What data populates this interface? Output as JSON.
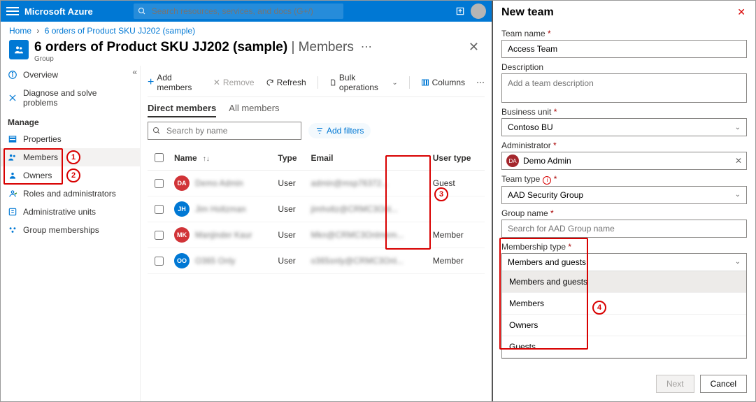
{
  "brand": "Microsoft Azure",
  "search_placeholder": "Search resources, services, and docs (G+/)",
  "breadcrumb": {
    "home": "Home",
    "current": "6 orders of Product SKU JJ202 (sample)"
  },
  "page": {
    "title_main": "6 orders of Product SKU JJ202 (sample)",
    "title_sep": " | ",
    "title_sub": "Members",
    "type": "Group"
  },
  "nav": {
    "overview": "Overview",
    "diagnose": "Diagnose and solve problems",
    "manage_header": "Manage",
    "properties": "Properties",
    "members": "Members",
    "owners": "Owners",
    "roles": "Roles and administrators",
    "admin_units": "Administrative units",
    "group_memberships": "Group memberships"
  },
  "toolbar": {
    "add": "Add members",
    "remove": "Remove",
    "refresh": "Refresh",
    "bulk": "Bulk operations",
    "columns": "Columns"
  },
  "tabs": {
    "direct": "Direct members",
    "all": "All members"
  },
  "search_name_placeholder": "Search by name",
  "add_filters": "Add filters",
  "columns": {
    "name": "Name",
    "type": "Type",
    "email": "Email",
    "user_type": "User type"
  },
  "rows": [
    {
      "initials": "DA",
      "color": "#d13438",
      "name": "Demo Admin",
      "type": "User",
      "email": "admin@msp76372...",
      "user_type": "Guest"
    },
    {
      "initials": "JH",
      "color": "#0078d4",
      "name": "Jim Holtzman",
      "type": "User",
      "email": "jimholtz@CRMC3Onl...",
      "user_type": ""
    },
    {
      "initials": "MK",
      "color": "#d13438",
      "name": "Manjinder Kaur",
      "type": "User",
      "email": "Mkn@CRMC3Onlmem...",
      "user_type": "Member"
    },
    {
      "initials": "OO",
      "color": "#0078d4",
      "name": "O365 Only",
      "type": "User",
      "email": "o365only@CRMC3Onl...",
      "user_type": "Member"
    }
  ],
  "panel": {
    "title": "New team",
    "team_name_label": "Team name",
    "team_name_value": "Access Team",
    "description_label": "Description",
    "description_placeholder": "Add a team description",
    "bu_label": "Business unit",
    "bu_value": "Contoso BU",
    "admin_label": "Administrator",
    "admin_value": "Demo Admin",
    "team_type_label": "Team type",
    "team_type_value": "AAD Security Group",
    "group_name_label": "Group name",
    "group_name_placeholder": "Search for AAD Group name",
    "membership_label": "Membership type",
    "membership_value": "Members and guests",
    "membership_options": [
      "Members and guests",
      "Members",
      "Owners",
      "Guests"
    ],
    "next": "Next",
    "cancel": "Cancel"
  }
}
